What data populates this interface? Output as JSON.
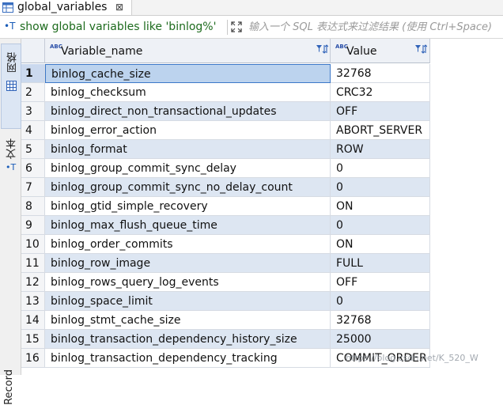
{
  "tab": {
    "title": "global_variables",
    "close": "⊠"
  },
  "filter": {
    "sql_icon": "•T",
    "sql": "show global variables like 'binlog%'",
    "placeholder": "输入一个 SQL 表达式来过滤结果 (使用 Ctrl+Space)"
  },
  "side": {
    "grid_label": "网格",
    "text_label": "文本",
    "record_label": "Record"
  },
  "columns": [
    {
      "type_icon": "ABC",
      "label": "Variable_name"
    },
    {
      "type_icon": "ABC",
      "label": "Value"
    }
  ],
  "rows": [
    {
      "num": "1",
      "name": "binlog_cache_size",
      "value": "32768"
    },
    {
      "num": "2",
      "name": "binlog_checksum",
      "value": "CRC32"
    },
    {
      "num": "3",
      "name": "binlog_direct_non_transactional_updates",
      "value": "OFF"
    },
    {
      "num": "4",
      "name": "binlog_error_action",
      "value": "ABORT_SERVER"
    },
    {
      "num": "5",
      "name": "binlog_format",
      "value": "ROW"
    },
    {
      "num": "6",
      "name": "binlog_group_commit_sync_delay",
      "value": "0"
    },
    {
      "num": "7",
      "name": "binlog_group_commit_sync_no_delay_count",
      "value": "0"
    },
    {
      "num": "8",
      "name": "binlog_gtid_simple_recovery",
      "value": "ON"
    },
    {
      "num": "9",
      "name": "binlog_max_flush_queue_time",
      "value": "0"
    },
    {
      "num": "10",
      "name": "binlog_order_commits",
      "value": "ON"
    },
    {
      "num": "11",
      "name": "binlog_row_image",
      "value": "FULL"
    },
    {
      "num": "12",
      "name": "binlog_rows_query_log_events",
      "value": "OFF"
    },
    {
      "num": "13",
      "name": "binlog_space_limit",
      "value": "0"
    },
    {
      "num": "14",
      "name": "binlog_stmt_cache_size",
      "value": "32768"
    },
    {
      "num": "15",
      "name": "binlog_transaction_dependency_history_size",
      "value": "25000"
    },
    {
      "num": "16",
      "name": "binlog_transaction_dependency_tracking",
      "value": "COMMIT_ORDER"
    }
  ],
  "watermark": "https://blog.csdn.net/K_520_W",
  "colors": {
    "selection": "#bcd3ee",
    "alt_row": "#dde6f2",
    "sql_text": "#1d6b1d",
    "accent": "#1a5cb8"
  }
}
